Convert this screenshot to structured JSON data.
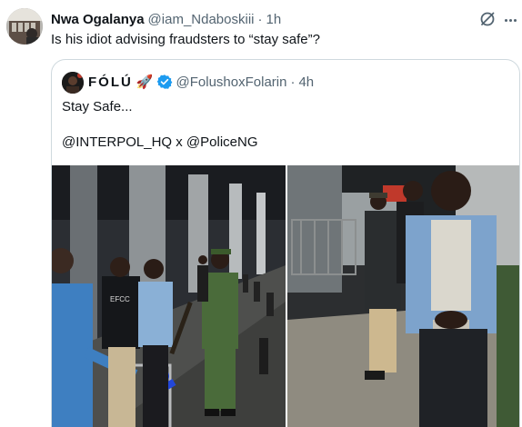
{
  "tweet": {
    "author_name": "Nwa Ogalanya",
    "handle": "@iam_Ndaboskiii",
    "separator": "·",
    "time": "1h",
    "text": "Is his idiot advising fraudsters to “stay safe”?"
  },
  "quoted": {
    "author_name": "FÓLÚ",
    "emoji": "🚀",
    "handle": "@FolushoxFolarin",
    "separator": "·",
    "time": "4h",
    "line1": "Stay Safe...",
    "line2": "@INTERPOL_HQ x @PoliceNG"
  },
  "photos": {
    "left_vest_text": "EFCC"
  },
  "icons": {
    "grok": "grok-icon",
    "more": "more-icon",
    "verified": "verified-badge-icon"
  },
  "colors": {
    "text": "#0f1419",
    "secondary": "#536471",
    "border": "#cfd9de",
    "verified": "#1d9bf0"
  }
}
